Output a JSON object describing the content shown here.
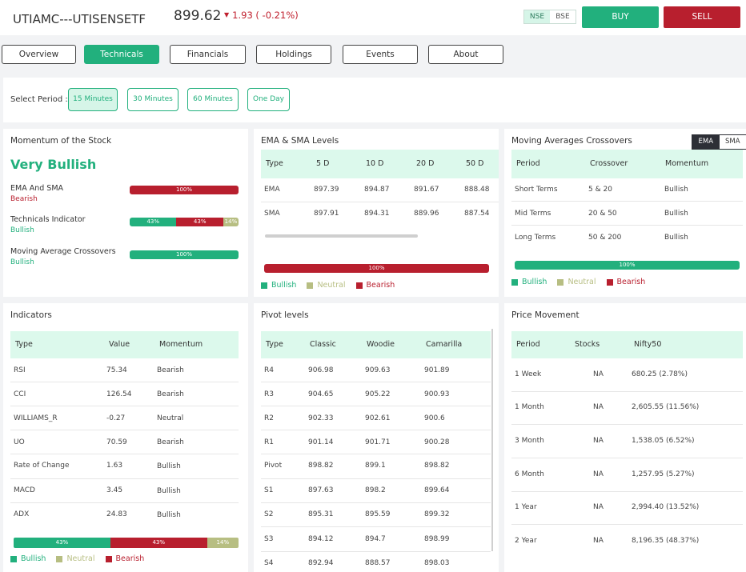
{
  "header": {
    "symbol": "UTIAMC---UTISENSETF",
    "price": "899.62",
    "change": "1.93 ( -0.21%)",
    "exchanges": [
      "NSE",
      "BSE"
    ],
    "buy_label": "BUY",
    "sell_label": "SELL",
    "colors": {
      "bullish": "#22b07d",
      "bearish": "#b81f2e",
      "neutral": "#b7be82"
    }
  },
  "nav": {
    "tabs": [
      "Overview",
      "Technicals",
      "Financials",
      "Holdings",
      "Events",
      "About"
    ],
    "active": "Technicals"
  },
  "period": {
    "label": "Select Period :",
    "options": [
      "15 Minutes",
      "30 Minutes",
      "60 Minutes",
      "One Day"
    ],
    "selected": "15 Minutes"
  },
  "momentum": {
    "title": "Momentum of the Stock",
    "verdict": "Very Bullish",
    "items": [
      {
        "label": "EMA And SMA",
        "value": "Bearish",
        "bar": [
          {
            "label": "100%",
            "pct": 100,
            "kind": "bearish"
          }
        ]
      },
      {
        "label": "Technicals Indicator",
        "value": "Bullish",
        "bar": [
          {
            "label": "43%",
            "pct": 43,
            "kind": "bullish"
          },
          {
            "label": "43%",
            "pct": 43,
            "kind": "bearish"
          },
          {
            "label": "14%",
            "pct": 14,
            "kind": "neutral"
          }
        ]
      },
      {
        "label": "Moving Average Crossovers",
        "value": "Bullish",
        "bar": [
          {
            "label": "100%",
            "pct": 100,
            "kind": "bullish"
          }
        ]
      }
    ]
  },
  "ema_sma": {
    "title": "EMA & SMA Levels",
    "columns": [
      "Type",
      "5 D",
      "10 D",
      "20 D",
      "50 D"
    ],
    "rows": [
      [
        "EMA",
        "897.39",
        "894.87",
        "891.67",
        "888.48"
      ],
      [
        "SMA",
        "897.91",
        "894.31",
        "889.96",
        "887.54"
      ]
    ],
    "bar_label": "100%",
    "legend": [
      "Bullish",
      "Neutral",
      "Bearish"
    ]
  },
  "crossovers": {
    "title": "Moving Averages Crossovers",
    "toggle": [
      "EMA",
      "SMA"
    ],
    "columns": [
      "Period",
      "Crossover",
      "Momentum"
    ],
    "rows": [
      [
        "Short Terms",
        "5 & 20",
        "Bullish"
      ],
      [
        "Mid Terms",
        "20 & 50",
        "Bullish"
      ],
      [
        "Long Terms",
        "50 & 200",
        "Bullish"
      ]
    ],
    "bar_label": "100%",
    "legend": [
      "Bullish",
      "Neutral",
      "Bearish"
    ]
  },
  "indicators": {
    "title": "Indicators",
    "columns": [
      "Type",
      "Value",
      "Momentum"
    ],
    "rows": [
      [
        "RSI",
        "75.34",
        "Bearish"
      ],
      [
        "CCI",
        "126.54",
        "Bearish"
      ],
      [
        "WILLIAMS_R",
        "-0.27",
        "Neutral"
      ],
      [
        "UO",
        "70.59",
        "Bearish"
      ],
      [
        "Rate of Change",
        "1.63",
        "Bullish"
      ],
      [
        "MACD",
        "3.45",
        "Bullish"
      ],
      [
        "ADX",
        "24.83",
        "Bullish"
      ]
    ],
    "bar": [
      {
        "label": "43%",
        "pct": 43,
        "kind": "bullish"
      },
      {
        "label": "43%",
        "pct": 43,
        "kind": "bearish"
      },
      {
        "label": "14%",
        "pct": 14,
        "kind": "neutral"
      }
    ],
    "legend": [
      "Bullish",
      "Neutral",
      "Bearish"
    ]
  },
  "pivot": {
    "title": "Pivot levels",
    "columns": [
      "Type",
      "Classic",
      "Woodie",
      "Camarilla"
    ],
    "rows": [
      [
        "R4",
        "906.98",
        "909.63",
        "901.89"
      ],
      [
        "R3",
        "904.65",
        "905.22",
        "900.93"
      ],
      [
        "R2",
        "902.33",
        "902.61",
        "900.6"
      ],
      [
        "R1",
        "901.14",
        "901.71",
        "900.28"
      ],
      [
        "Pivot",
        "898.82",
        "899.1",
        "898.82"
      ],
      [
        "S1",
        "897.63",
        "898.2",
        "899.64"
      ],
      [
        "S2",
        "895.31",
        "895.59",
        "899.32"
      ],
      [
        "S3",
        "894.12",
        "894.7",
        "898.99"
      ],
      [
        "S4",
        "892.94",
        "888.57",
        "898.03"
      ]
    ]
  },
  "price_movement": {
    "title": "Price Movement",
    "columns": [
      "Period",
      "Stocks",
      "Nifty50"
    ],
    "rows": [
      [
        "1 Week",
        "NA",
        "680.25 (2.78%)"
      ],
      [
        "1 Month",
        "NA",
        "2,605.55 (11.56%)"
      ],
      [
        "3 Month",
        "NA",
        "1,538.05 (6.52%)"
      ],
      [
        "6 Month",
        "NA",
        "1,257.95 (5.27%)"
      ],
      [
        "1 Year",
        "NA",
        "2,994.40 (13.52%)"
      ],
      [
        "2 Year",
        "NA",
        "8,196.35 (48.37%)"
      ]
    ]
  }
}
